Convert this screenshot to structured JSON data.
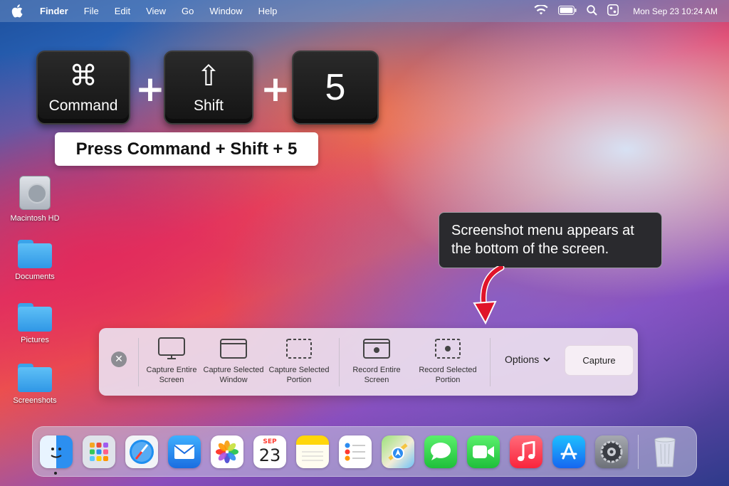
{
  "menubar": {
    "app_name": "Finder",
    "items": [
      "File",
      "Edit",
      "View",
      "Go",
      "Window",
      "Help"
    ],
    "clock": "Mon Sep 23  10:24 AM"
  },
  "keys": {
    "command_symbol": "⌘",
    "command_label": "Command",
    "shift_symbol": "⇧",
    "shift_label": "Shift",
    "five_label": "5",
    "plus": "+"
  },
  "press_caption": "Press Command + Shift + 5",
  "desktop_icons": [
    {
      "label": "Macintosh HD",
      "icon": "hard-drive-icon"
    },
    {
      "label": "Documents",
      "icon": "folder-icon"
    },
    {
      "label": "Pictures",
      "icon": "folder-icon"
    },
    {
      "label": "Screenshots",
      "icon": "folder-icon"
    }
  ],
  "callout": {
    "text": "Screenshot menu appears at the bottom of the screen.",
    "arrow_color": "#e0142a"
  },
  "toolbar": {
    "close_symbol": "✕",
    "buttons": [
      {
        "label": "Capture Entire Screen",
        "icon": "capture-entire-screen-icon"
      },
      {
        "label": "Capture Selected Window",
        "icon": "capture-window-icon"
      },
      {
        "label": "Capture Selected Portion",
        "icon": "capture-portion-icon"
      },
      {
        "label": "Record Entire Screen",
        "icon": "record-screen-icon"
      },
      {
        "label": "Record Selected Portion",
        "icon": "record-portion-icon"
      }
    ],
    "options_label": "Options",
    "capture_label": "Capture"
  },
  "dock": {
    "apps": [
      "finder-icon",
      "launchpad-icon",
      "safari-icon",
      "mail-icon",
      "photos-icon",
      "calendar-icon",
      "notes-icon",
      "reminders-icon",
      "maps-icon",
      "messages-icon",
      "facetime-icon",
      "music-icon",
      "app-store-icon",
      "system-preferences-icon",
      "trash-icon"
    ],
    "calendar_month": "SEP",
    "calendar_day": "23"
  }
}
